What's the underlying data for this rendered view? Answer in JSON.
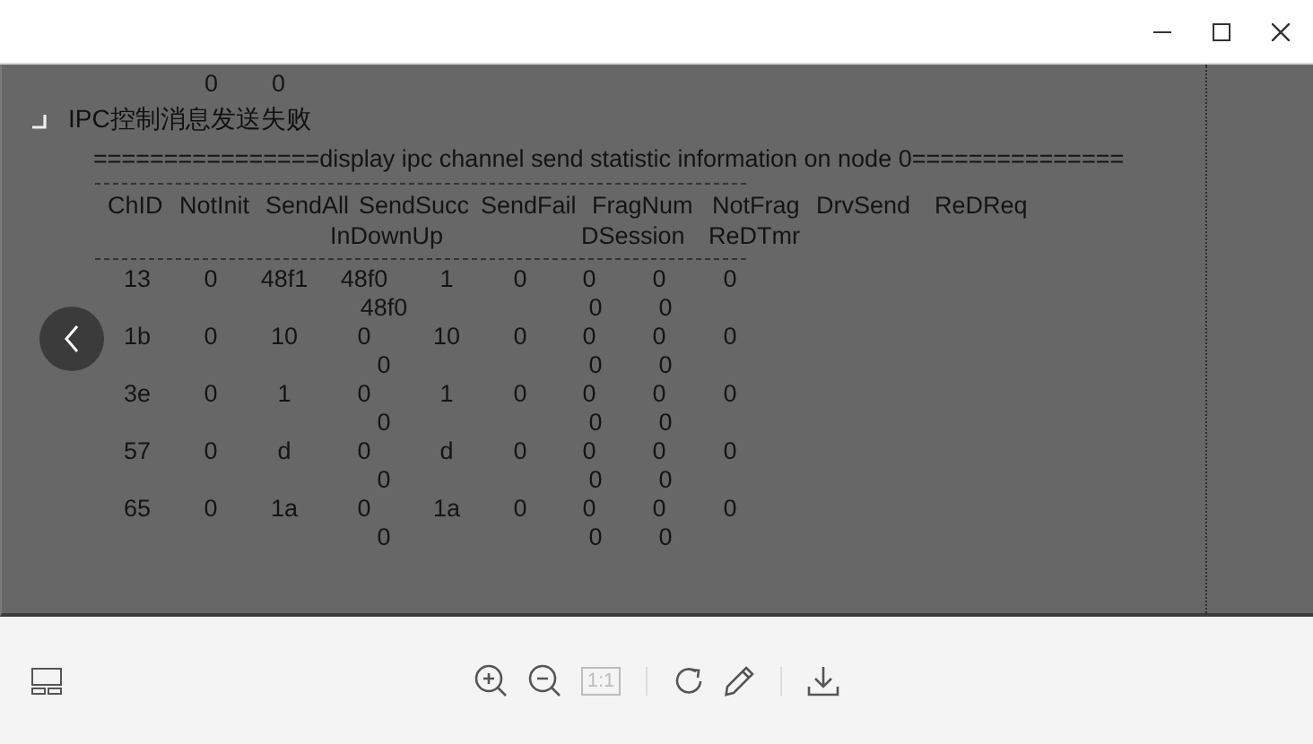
{
  "window": {
    "controls": [
      {
        "kind": "minimize"
      },
      {
        "kind": "maximize"
      },
      {
        "kind": "close"
      }
    ]
  },
  "document": {
    "top_values": [
      "0",
      "0"
    ],
    "heading": "IPC控制消息发送失败",
    "banner": "================display ipc channel send statistic information on node 0===============",
    "columns": [
      {
        "name": "ChID"
      },
      {
        "name": "NotInit"
      },
      {
        "name": "SendAll"
      },
      {
        "name": "SendSucc",
        "sub": "InDownUp"
      },
      {
        "name": "SendFail"
      },
      {
        "name": "FragNum",
        "sub": "DSession"
      },
      {
        "name": "NotFrag",
        "sub": "ReDTmr"
      },
      {
        "name": "DrvSend"
      },
      {
        "name": "ReDReq"
      }
    ],
    "rows": [
      {
        "values": [
          "13",
          "0",
          "48f1",
          "48f0",
          "1",
          "0",
          "0",
          "0",
          "0"
        ],
        "sub_values": [
          "48f0",
          "0",
          "0"
        ]
      },
      {
        "values": [
          "1b",
          "0",
          "10",
          "0",
          "10",
          "0",
          "0",
          "0",
          "0"
        ],
        "sub_values": [
          "0",
          "0",
          "0"
        ]
      },
      {
        "values": [
          "3e",
          "0",
          "1",
          "0",
          "1",
          "0",
          "0",
          "0",
          "0"
        ],
        "sub_values": [
          "0",
          "0",
          "0"
        ]
      },
      {
        "values": [
          "57",
          "0",
          "d",
          "0",
          "d",
          "0",
          "0",
          "0",
          "0"
        ],
        "sub_values": [
          "0",
          "0",
          "0"
        ]
      },
      {
        "values": [
          "65",
          "0",
          "1a",
          "0",
          "1a",
          "0",
          "0",
          "0",
          "0"
        ],
        "sub_values": [
          "0",
          "0",
          "0"
        ]
      }
    ]
  },
  "toolbar": {
    "left": [
      {
        "kind": "thumbnails",
        "disabled": false
      }
    ],
    "groups": [
      [
        {
          "kind": "zoom-in",
          "disabled": false
        },
        {
          "kind": "zoom-out",
          "disabled": false
        },
        {
          "kind": "actual-size",
          "label": "1:1",
          "disabled": true
        }
      ],
      [
        {
          "kind": "rotate",
          "disabled": false
        },
        {
          "kind": "edit",
          "disabled": false
        }
      ],
      [
        {
          "kind": "download",
          "disabled": false
        }
      ]
    ]
  }
}
